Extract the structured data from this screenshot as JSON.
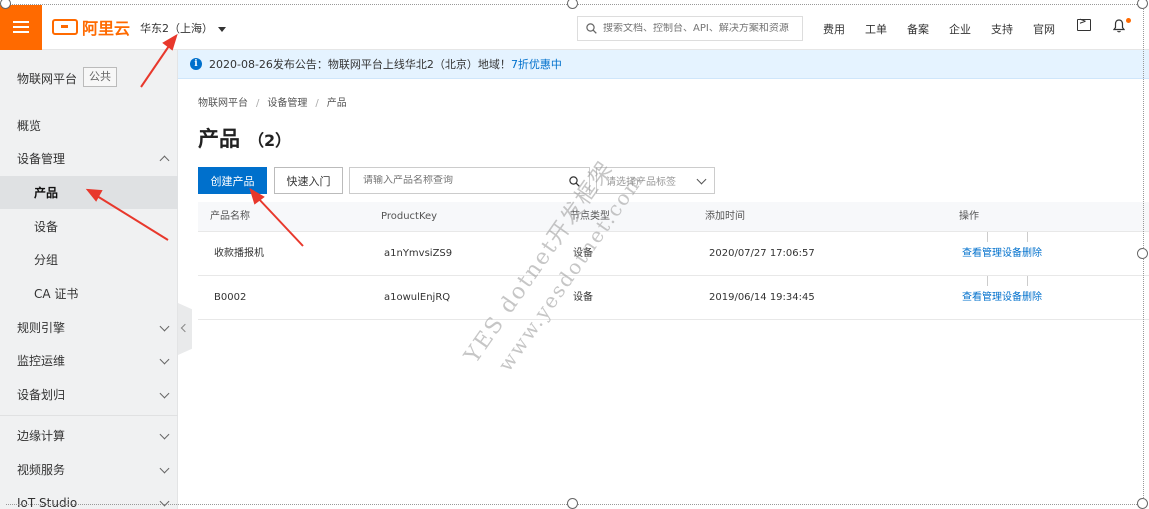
{
  "brand": {
    "name": "阿里云"
  },
  "top": {
    "region": "华东2（上海）",
    "search_placeholder": "搜索文档、控制台、API、解决方案和资源",
    "links": [
      "费用",
      "工单",
      "备案",
      "企业",
      "支持",
      "官网"
    ]
  },
  "sidebar": {
    "title": "物联网平台",
    "badge": "公共",
    "items": [
      {
        "label": "概览"
      },
      {
        "label": "设备管理"
      },
      {
        "label": "产品"
      },
      {
        "label": "设备"
      },
      {
        "label": "分组"
      },
      {
        "label": "CA 证书"
      },
      {
        "label": "规则引擎"
      },
      {
        "label": "监控运维"
      },
      {
        "label": "设备划归"
      },
      {
        "label": "边缘计算"
      },
      {
        "label": "视频服务"
      },
      {
        "label": "IoT Studio"
      }
    ]
  },
  "notice": {
    "text": "2020-08-26发布公告：物联网平台上线华北2（北京）地域！",
    "link": "7折优惠中"
  },
  "breadcrumb": [
    "物联网平台",
    "设备管理",
    "产品"
  ],
  "page": {
    "title": "产品",
    "count": "（2）"
  },
  "toolbar": {
    "create_label": "创建产品",
    "quickstart_label": "快速入门",
    "search_placeholder": "请输入产品名称查询",
    "tag_placeholder": "请选择产品标签"
  },
  "table": {
    "headers": [
      "产品名称",
      "ProductKey",
      "节点类型",
      "添加时间",
      "操作"
    ],
    "rows": [
      {
        "name": "收款播报机",
        "key": "a1nYmvsiZS9",
        "node": "设备",
        "time": "2020/07/27 17:06:57"
      },
      {
        "name": "B0002",
        "key": "a1owulEnjRQ",
        "node": "设备",
        "time": "2019/06/14 19:34:45"
      }
    ],
    "actions": [
      "查看",
      "管理设备",
      "删除"
    ]
  },
  "watermark": [
    "YES dotnet开发框架",
    "www.yesdotnet.com"
  ],
  "colors": {
    "accent": "#ff6a00",
    "primary": "#0070cc",
    "annotation": "#e8382c"
  }
}
